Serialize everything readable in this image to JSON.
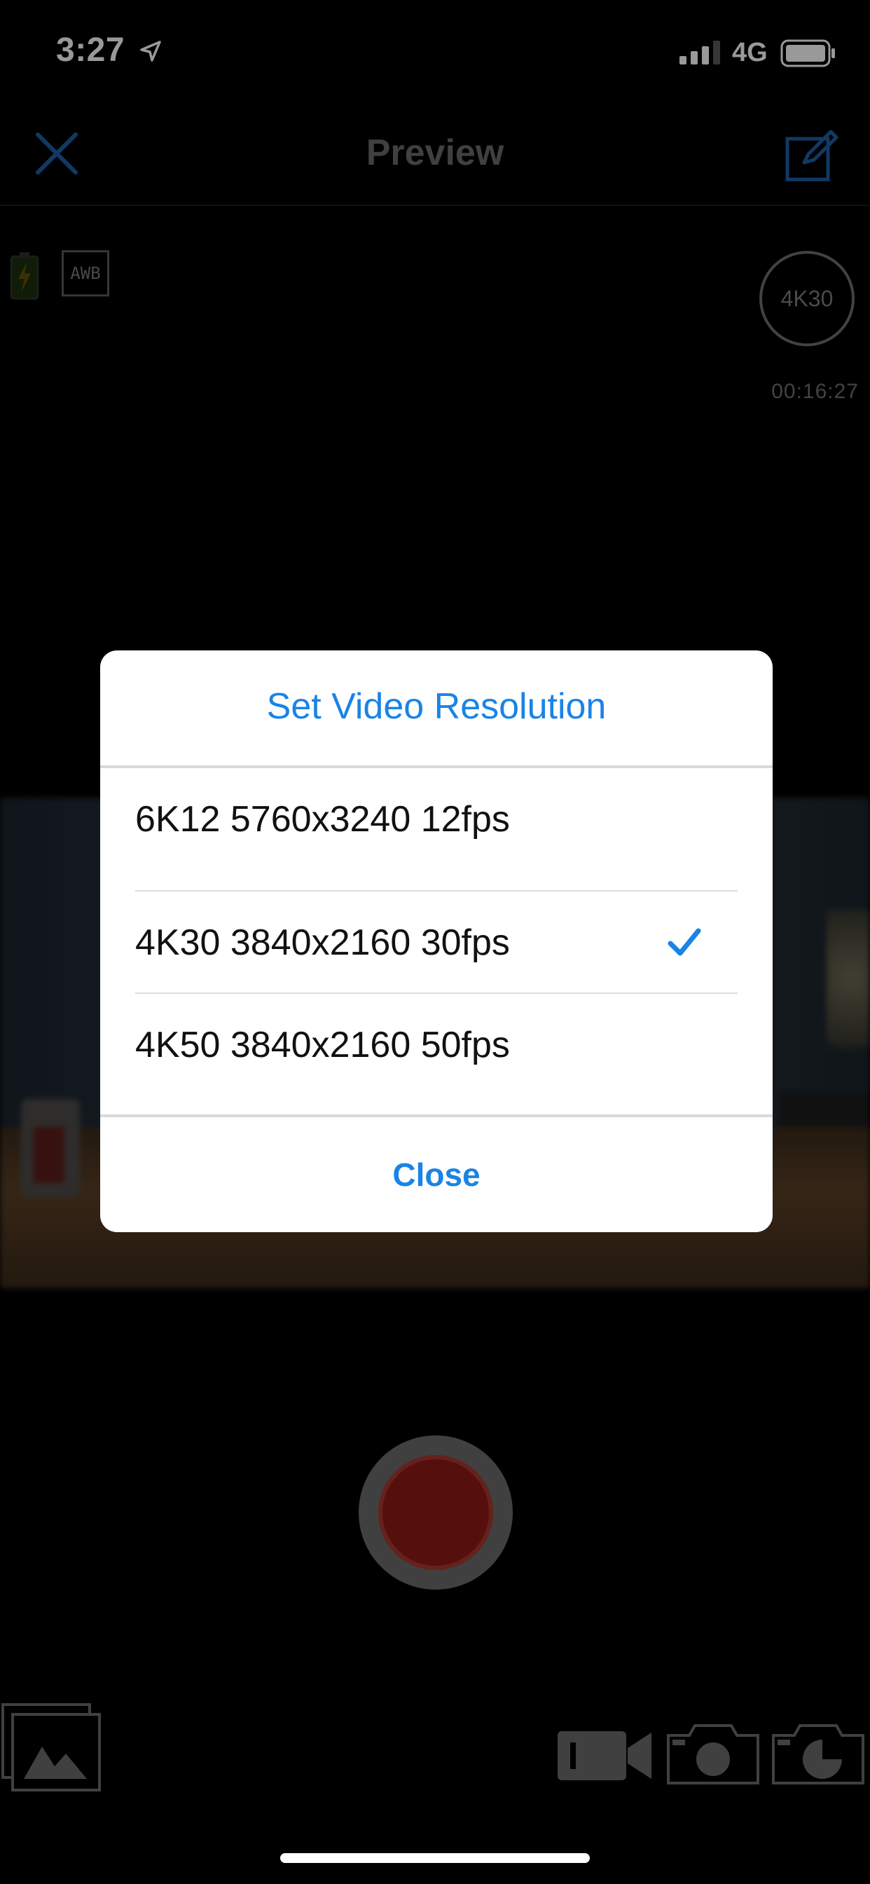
{
  "status_bar": {
    "time": "3:27",
    "network": "4G",
    "icons": [
      "location-arrow-icon",
      "cellular-signal-icon",
      "battery-icon"
    ]
  },
  "nav": {
    "title": "Preview",
    "close_icon": "close-x-icon",
    "edit_icon": "edit-icon",
    "accent_color": "#1f5fa8"
  },
  "camera": {
    "awb_label": "AWB",
    "resolution_badge": "4K30",
    "recording_time": "00:16:27",
    "battery_icon": "battery-charging-icon"
  },
  "dialog": {
    "title": "Set Video Resolution",
    "options": [
      {
        "label": "6K12 5760x3240 12fps",
        "selected": false
      },
      {
        "label": "4K30 3840x2160 30fps",
        "selected": true
      },
      {
        "label": "4K50 3840x2160 50fps",
        "selected": false
      }
    ],
    "close_label": "Close",
    "accent_color": "#1a83e6"
  },
  "controls": {
    "shutter_icon": "record-button",
    "gallery_icon": "gallery-icon",
    "modes": [
      "video-camera-icon",
      "photo-camera-icon",
      "timelapse-icon"
    ]
  }
}
